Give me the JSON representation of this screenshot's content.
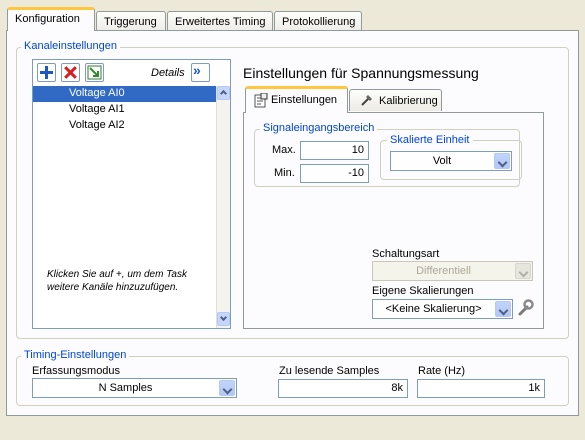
{
  "tabs": [
    "Konfiguration",
    "Triggerung",
    "Erweitertes Timing",
    "Protokollierung"
  ],
  "channel_settings": {
    "legend": "Kanaleinstellungen",
    "details_label": "Details",
    "channels": [
      "Voltage AI0",
      "Voltage AI1",
      "Voltage AI2"
    ],
    "hint": "Klicken Sie auf +, um dem Task weitere Kanäle hinzuzufügen."
  },
  "voltage": {
    "title": "Einstellungen für Spannungsmessung",
    "tabs": [
      "Einstellungen",
      "Kalibrierung"
    ],
    "input_range_legend": "Signaleingangsbereich",
    "max_label": "Max.",
    "max_value": "10",
    "min_label": "Min.",
    "min_value": "-10",
    "scaled_unit_legend": "Skalierte Einheit",
    "scaled_unit_value": "Volt",
    "terminal_config_label": "Schaltungsart",
    "terminal_config_value": "Differentiell",
    "custom_scaling_label": "Eigene Skalierungen",
    "custom_scaling_value": "<Keine Skalierung>"
  },
  "timing": {
    "legend": "Timing-Einstellungen",
    "mode_label": "Erfassungsmodus",
    "mode_value": "N Samples",
    "samples_label": "Zu lesende Samples",
    "samples_value": "8k",
    "rate_label": "Rate (Hz)",
    "rate_value": "1k"
  }
}
